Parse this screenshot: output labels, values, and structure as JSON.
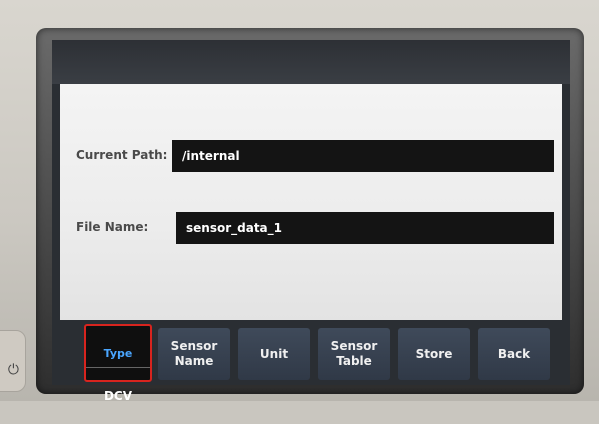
{
  "form": {
    "current_path_label": "Current Path:",
    "current_path_value": "/internal",
    "file_name_label": "File Name:",
    "file_name_value": "sensor_data_1"
  },
  "softkeys": {
    "type_label": "Type",
    "type_value": "DCV",
    "sensor_name": "Sensor\nName",
    "unit": "Unit",
    "sensor_table": "Sensor\nTable",
    "store": "Store",
    "back": "Back"
  },
  "colors": {
    "panel_bg": "#ececec",
    "field_bg": "#141414",
    "softkey_bg": "#34404f",
    "selected_border": "#d8241e",
    "type_label_color": "#4aa6ff"
  },
  "device": {
    "power_icon": "power-icon"
  }
}
